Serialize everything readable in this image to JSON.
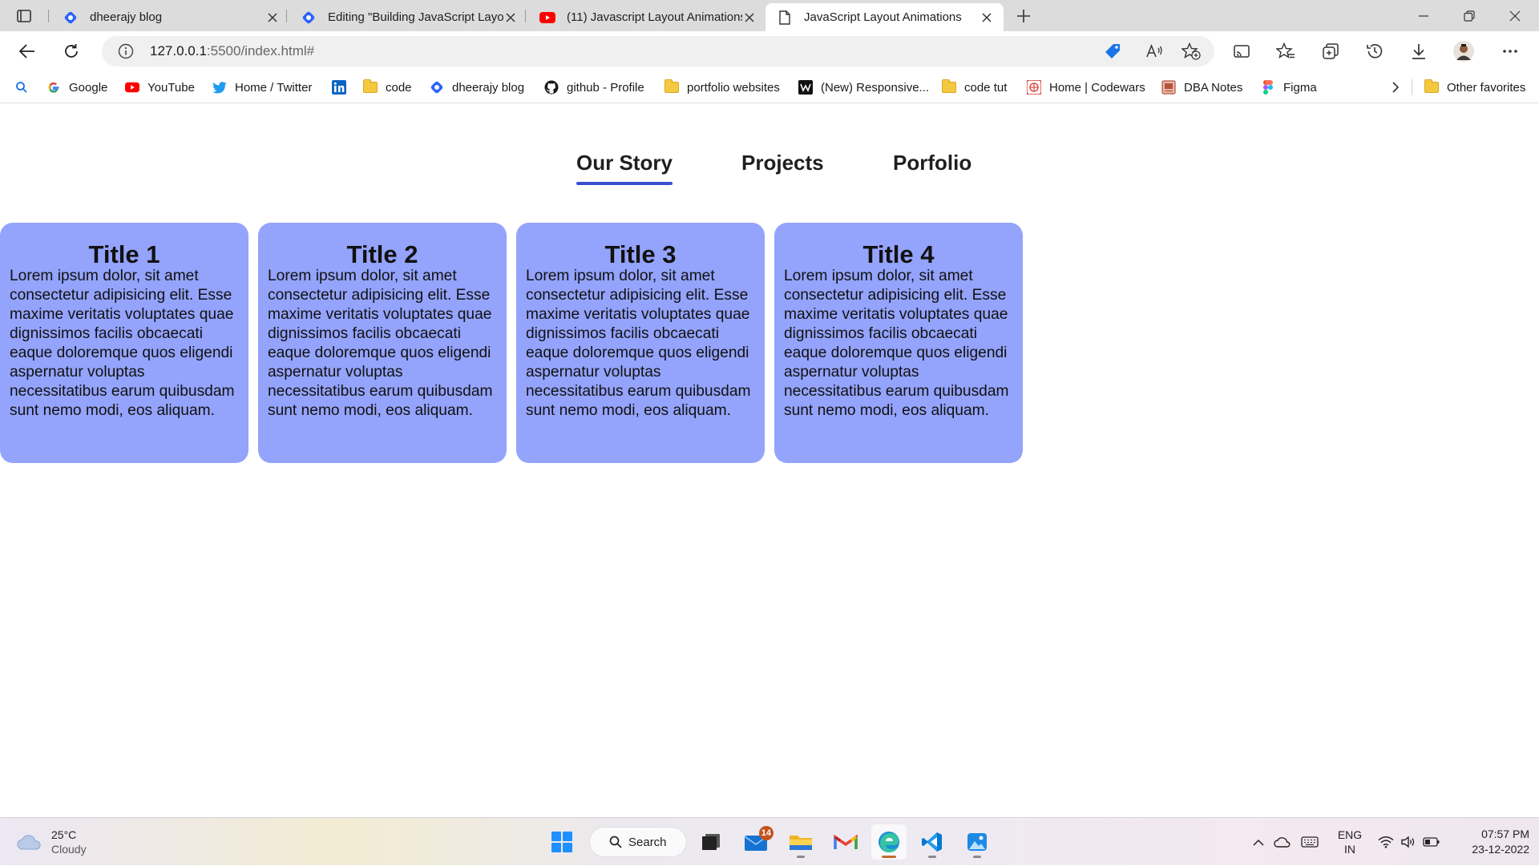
{
  "browser": {
    "tabs": [
      {
        "title": "dheerajy blog",
        "active": false
      },
      {
        "title": "Editing \"Building JavaScript Layou",
        "active": false
      },
      {
        "title": "(11) Javascript Layout Animations",
        "active": false
      },
      {
        "title": "JavaScript Layout Animations",
        "active": true
      }
    ],
    "address": {
      "host": "127.0.0.1",
      "path": ":5500/index.html#"
    },
    "favorites": [
      {
        "label": "Google",
        "icon": "google-icon"
      },
      {
        "label": "YouTube",
        "icon": "youtube-icon"
      },
      {
        "label": "Home / Twitter",
        "icon": "twitter-icon"
      },
      {
        "label": "",
        "icon": "linkedin-icon"
      },
      {
        "label": "code",
        "icon": "folder-icon"
      },
      {
        "label": "dheerajy blog",
        "icon": "hashnode-icon"
      },
      {
        "label": "github - Profile",
        "icon": "github-icon"
      },
      {
        "label": "portfolio websites",
        "icon": "folder-icon"
      },
      {
        "label": "(New) Responsive...",
        "icon": "webflow-icon"
      },
      {
        "label": "code tut",
        "icon": "folder-icon"
      },
      {
        "label": "Home | Codewars",
        "icon": "codewars-icon"
      },
      {
        "label": "DBA Notes",
        "icon": "notes-icon"
      },
      {
        "label": "Figma",
        "icon": "figma-icon"
      }
    ],
    "other_favorites": "Other favorites"
  },
  "page": {
    "nav": [
      {
        "label": "Our Story",
        "active": true
      },
      {
        "label": "Projects",
        "active": false
      },
      {
        "label": "Porfolio",
        "active": false
      }
    ],
    "cards": [
      {
        "title": "Title 1",
        "body": "Lorem ipsum dolor, sit amet consectetur adipisicing elit. Esse maxime veritatis voluptates quae dignissimos facilis obcaecati eaque doloremque quos eligendi aspernatur voluptas necessitatibus earum quibusdam sunt nemo modi, eos aliquam."
      },
      {
        "title": "Title 2",
        "body": "Lorem ipsum dolor, sit amet consectetur adipisicing elit. Esse maxime veritatis voluptates quae dignissimos facilis obcaecati eaque doloremque quos eligendi aspernatur voluptas necessitatibus earum quibusdam sunt nemo modi, eos aliquam."
      },
      {
        "title": "Title 3",
        "body": "Lorem ipsum dolor, sit amet consectetur adipisicing elit. Esse maxime veritatis voluptates quae dignissimos facilis obcaecati eaque doloremque quos eligendi aspernatur voluptas necessitatibus earum quibusdam sunt nemo modi, eos aliquam."
      },
      {
        "title": "Title 4",
        "body": "Lorem ipsum dolor, sit amet consectetur adipisicing elit. Esse maxime veritatis voluptates quae dignissimos facilis obcaecati eaque doloremque quos eligendi aspernatur voluptas necessitatibus earum quibusdam sunt nemo modi, eos aliquam."
      }
    ],
    "colors": {
      "card_bg": "#94a3fb",
      "nav_underline": "#3a4fd0"
    }
  },
  "taskbar": {
    "weather": {
      "temp": "25°C",
      "condition": "Cloudy"
    },
    "search_label": "Search",
    "mail_badge": "14",
    "language": {
      "lang": "ENG",
      "region": "IN"
    },
    "clock": {
      "time": "07:57 PM",
      "date": "23-12-2022"
    }
  }
}
